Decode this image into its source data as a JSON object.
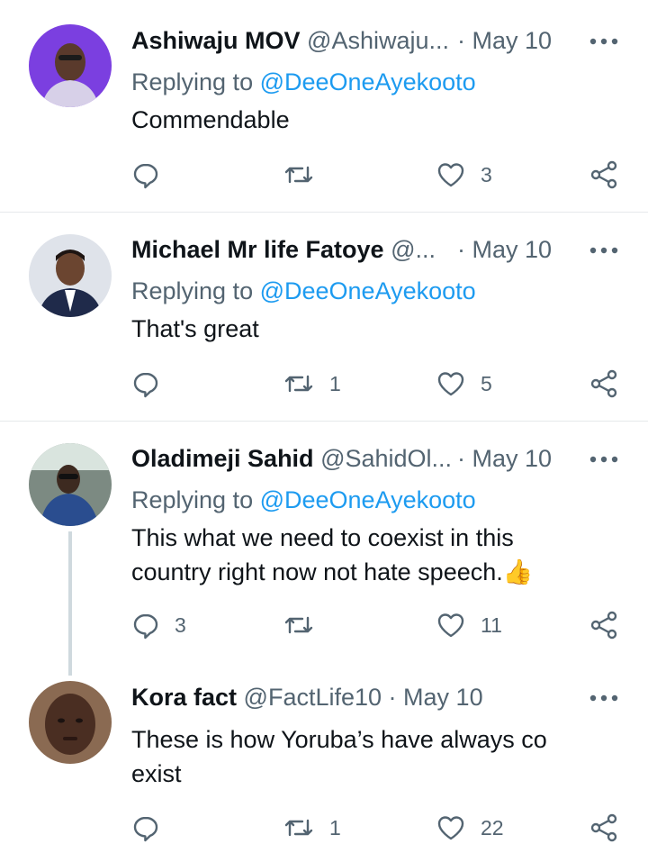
{
  "tweets": [
    {
      "name": "Ashiwaju MOV",
      "handle": "@Ashiwaju...",
      "date": "· May 10",
      "reply_prefix": "Replying to ",
      "reply_to": "@DeeOneAyekooto",
      "text": "Commendable",
      "replies": "",
      "retweets": "",
      "likes": "3"
    },
    {
      "name": "Michael Mr life Fatoye",
      "handle": "@...",
      "date": "· May 10",
      "reply_prefix": "Replying to ",
      "reply_to": "@DeeOneAyekooto",
      "text": "That's great",
      "replies": "",
      "retweets": "1",
      "likes": "5"
    },
    {
      "name": "Oladimeji Sahid",
      "handle": "@SahidOl...",
      "date": "· May 10",
      "reply_prefix": "Replying to ",
      "reply_to": "@DeeOneAyekooto",
      "text": "This what we need to coexist in this country right now not hate speech.",
      "emoji": "👍",
      "replies": "3",
      "retweets": "",
      "likes": "11"
    },
    {
      "name": "Kora fact",
      "handle": "@FactLife10",
      "date": "· May 10",
      "text": "These is how Yoruba’s  have always co exist",
      "replies": "",
      "retweets": "1",
      "likes": "22"
    }
  ],
  "icons": {
    "reply": "reply-icon",
    "retweet": "retweet-icon",
    "like": "heart-icon",
    "share": "share-icon",
    "more": "more-icon"
  },
  "colors": {
    "link": "#1d9bf0",
    "secondary": "#536471",
    "divider": "#e6e9eb"
  }
}
